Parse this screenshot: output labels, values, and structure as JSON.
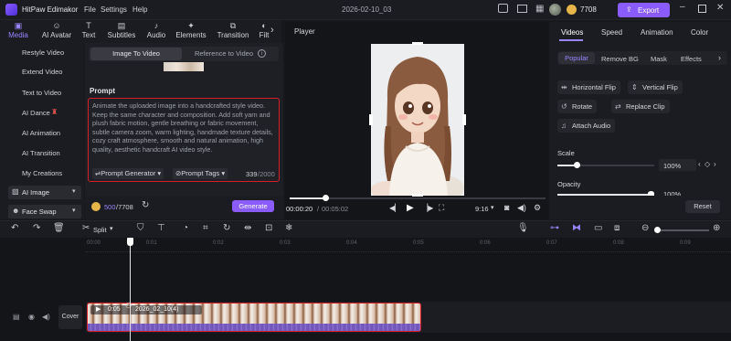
{
  "app": {
    "title": "HitPaw Edimakor",
    "menu": [
      "File",
      "Settings",
      "Help"
    ],
    "project": "2026-02-10_03",
    "credits": "7708",
    "export_label": "Export"
  },
  "toolbar": {
    "items": [
      {
        "label": "Media",
        "icon": "media-icon"
      },
      {
        "label": "AI Avatar",
        "icon": "ai-avatar-icon"
      },
      {
        "label": "Text",
        "icon": "text-icon"
      },
      {
        "label": "Subtitles",
        "icon": "subtitles-icon"
      },
      {
        "label": "Audio",
        "icon": "audio-icon"
      },
      {
        "label": "Elements",
        "icon": "elements-icon"
      },
      {
        "label": "Transition",
        "icon": "transition-icon"
      },
      {
        "label": "Filt",
        "icon": "filter-icon"
      }
    ]
  },
  "sidebar": {
    "items": [
      "Restyle Video",
      "Extend Video",
      "Text to Video",
      "AI Dance",
      "AI Animation",
      "AI Transition",
      "My Creations"
    ],
    "ai_image": "AI Image",
    "face_swap": "Face Swap"
  },
  "panel": {
    "tab_active": "Image To Video",
    "tab_other": "Reference to Video",
    "prompt_title": "Prompt",
    "prompt_text": "Animate the uploaded image into a handcrafted style video. Keep the same character and composition. Add soft yarn and plush fabric motion, gentle breathing or fabric movement, subtle camera zoom, warm lighting, handmade texture details, cozy craft atmosphere, smooth and natural animation, high quality, aesthetic handcraft AI video style.",
    "prompt_generator": "Prompt Generator",
    "prompt_tags": "Prompt Tags",
    "count": "339",
    "count_max": "/2000",
    "credit_used": "500",
    "credit_total": "/7708",
    "generate": "Generate"
  },
  "player": {
    "title": "Player",
    "time_current": "00:00:20",
    "time_total": "00:05:02",
    "ratio": "9:16",
    "progress": 0.14
  },
  "right": {
    "tabs": [
      "Videos",
      "Speed",
      "Animation",
      "Color"
    ],
    "subtabs": [
      "Popular",
      "Remove BG",
      "Mask",
      "Effects"
    ],
    "buttons": [
      "Horizontal Flip",
      "Vertical Flip",
      "Rotate",
      "Replace Clip",
      "Attach Audio"
    ],
    "scale_label": "Scale",
    "scale_value": "100%",
    "opacity_label": "Opacity",
    "opacity_value": "100%",
    "reset": "Reset"
  },
  "timeline": {
    "split": "Split",
    "ruler": [
      "00:00",
      "0:01",
      "0:02",
      "0:03",
      "0:04",
      "0:05",
      "0:06",
      "0:07",
      "0:08",
      "0:09"
    ],
    "cover": "Cover",
    "clip_time": "0:05",
    "clip_name": "2026_02_10(4)"
  }
}
